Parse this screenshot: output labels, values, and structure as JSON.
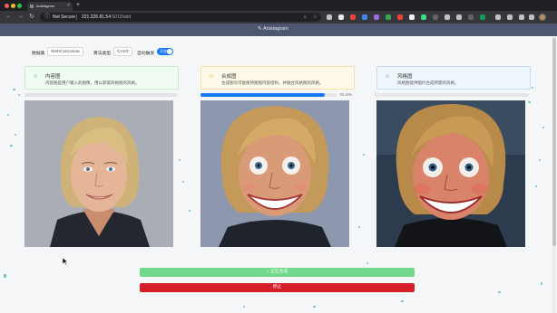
{
  "browser": {
    "tab_title": "Anistagram",
    "tab_close": "×",
    "new_tab": "+",
    "nav_back": "←",
    "nav_forward": "→",
    "nav_reload": "↻",
    "security_label": "Not Secure",
    "url_host": "221.226.81.54",
    "url_port": ":5010/add",
    "icon_names": [
      "info-icon",
      "search-icon",
      "share-icon",
      "bookmark-star-icon",
      "extensions-icon",
      "profile-avatar"
    ]
  },
  "app": {
    "title": "Anistagram"
  },
  "controls": {
    "dataset_label": "数据集",
    "dataset_value": "WebCaricature",
    "model_label": "算法类型",
    "model_value": "CAST",
    "auto_label": "自动触发",
    "auto_switch_text": "开启",
    "auto_enabled": true
  },
  "panels": [
    {
      "title": "内容图",
      "description": "内容图是用户输入的图像，用以获取风格图的风格。",
      "icon": "smile-icon",
      "color": "#f0fbf1"
    },
    {
      "title": "合成图",
      "description": "合成图尽可能保持图图内容结构，并融合风格图的风格。",
      "icon": "smile-icon",
      "color": "#fef9e8",
      "progress_percent": 91.6,
      "progress_label": "91.6%"
    },
    {
      "title": "风格图",
      "description": "风格图提供图片合成所需的风格。",
      "icon": "smile-icon",
      "color": "#eef6fc",
      "progress_percent": 0
    }
  ],
  "actions": {
    "generate_label": "○ 正在合成",
    "stop_label": "停止"
  },
  "colors": {
    "accent": "#1677ff",
    "generate": "#72d88b",
    "stop": "#d3202a",
    "header": "#4f5670"
  }
}
